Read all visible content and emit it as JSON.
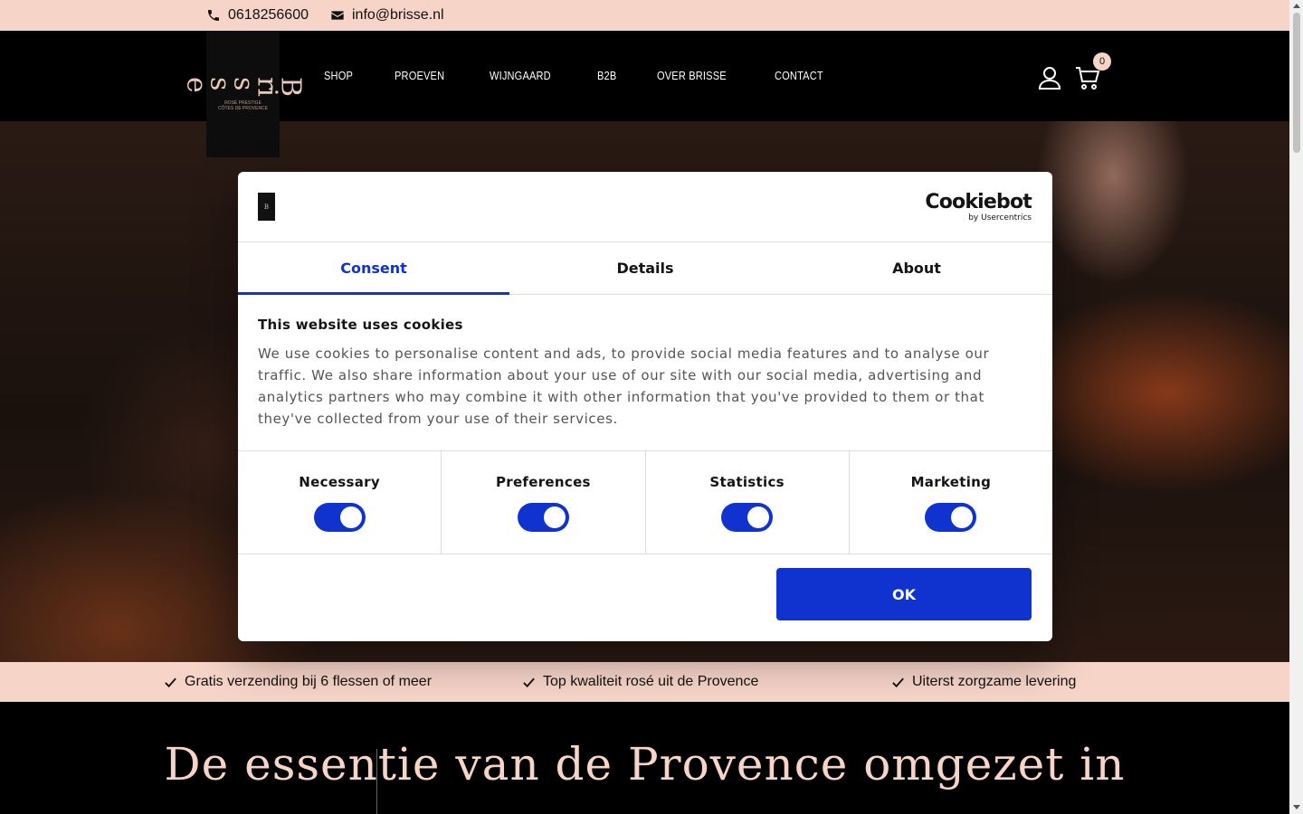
{
  "topbar": {
    "phone": "0618256600",
    "email": "info@brisse.nl"
  },
  "logo": {
    "mark": "Brisse",
    "sub": "ROSÉ PRESTIGE CÔTES DE PROVENCE"
  },
  "nav": {
    "items": [
      "SHOP",
      "PROEVEN",
      "WIJNGAARD",
      "B2B",
      "OVER BRISSE",
      "CONTACT"
    ]
  },
  "cart": {
    "count": "0"
  },
  "strip": {
    "usps": [
      "Gratis verzending bij 6 flessen of meer",
      "Top kwaliteit rosé uit de Provence",
      "Uiterst zorgzame levering"
    ]
  },
  "headline": "De essentie van de Provence omgezet in",
  "cookie": {
    "brand": "Cookiebot",
    "brand_sub": "by Usercentrics",
    "tabs": [
      "Consent",
      "Details",
      "About"
    ],
    "title": "This website uses cookies",
    "text": "We use cookies to personalise content and ads, to provide social media features and to analyse our traffic. We also share information about your use of our site with our social media, advertising and analytics partners who may combine it with other information that you've provided to them or that they've collected from your use of their services.",
    "toggles": [
      "Necessary",
      "Preferences",
      "Statistics",
      "Marketing"
    ],
    "ok_label": "OK"
  },
  "colors": {
    "accent": "#1032cf",
    "peach": "#f6d4c8"
  }
}
